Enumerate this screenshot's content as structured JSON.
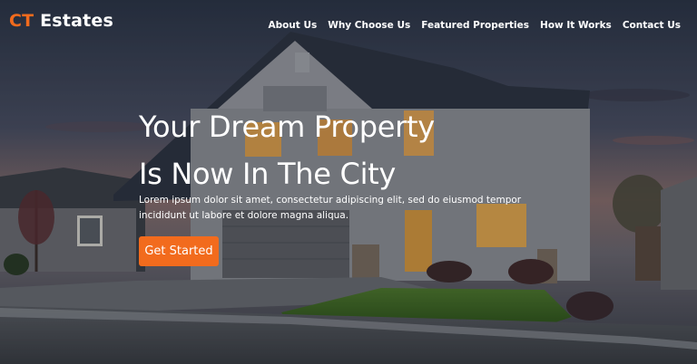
{
  "brand": {
    "accent": "CT",
    "rest": " Estates"
  },
  "nav": {
    "items": [
      {
        "label": "About Us"
      },
      {
        "label": "Why Choose Us"
      },
      {
        "label": "Featured Properties"
      },
      {
        "label": "How It Works"
      },
      {
        "label": "Contact Us"
      }
    ]
  },
  "hero": {
    "headline_line1": "Your Dream Property",
    "headline_line2": "Is Now In The City",
    "lead": "Lorem ipsum dolor sit amet, consectetur adipiscing elit, sed do eiusmod tempor incididunt ut labore et dolore magna aliqua.",
    "cta_label": "Get Started",
    "background_image": "house-at-dusk-photo"
  },
  "colors": {
    "accent": "#f26b1d",
    "text": "#ffffff"
  }
}
